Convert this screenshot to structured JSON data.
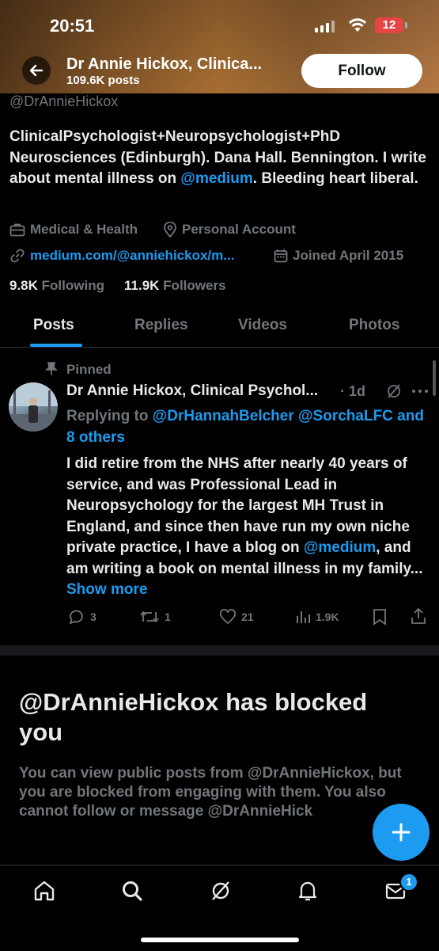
{
  "status_bar": {
    "time": "20:51",
    "battery": "12"
  },
  "header": {
    "name": "Dr Annie Hickox, Clinica...",
    "posts": "109.6K posts",
    "follow_label": "Follow"
  },
  "profile": {
    "handle": "@DrAnnieHickox",
    "bio_part1": "ClinicalPsychologist+Neuropsychologist+PhD Neurosciences (Edinburgh). Dana Hall. Bennington. I write about mental illness on ",
    "bio_link": "@medium",
    "bio_part2": ". Bleeding heart liberal.",
    "category": "Medical & Health",
    "account_type": "Personal Account",
    "website": "medium.com/@anniehickox/m...",
    "joined": "Joined April 2015",
    "following_count": "9.8K",
    "following_label": "Following",
    "followers_count": "11.9K",
    "followers_label": "Followers"
  },
  "tabs": [
    {
      "label": "Posts"
    },
    {
      "label": "Replies"
    },
    {
      "label": "Videos"
    },
    {
      "label": "Photos"
    }
  ],
  "pinned_post": {
    "pinned_label": "Pinned",
    "author": "Dr Annie Hickox, Clinical Psychol...",
    "time": "· 1d",
    "replying_prefix": "Replying to ",
    "replying_users": "@DrHannahBelcher @SorchaLFC and 8 others",
    "text_part1": "I did retire from the NHS after nearly 40 years of service, and was Professional Lead in Neuropsychology for the largest MH Trust in England, and since then have run my own niche private practice, I have a blog on ",
    "text_link": "@medium",
    "text_part2": ", and am writing a book on mental illness in my family... ",
    "show_more": "Show more",
    "replies": "3",
    "reposts": "1",
    "likes": "21",
    "views": "1.9K"
  },
  "blocked": {
    "title": "@DrAnnieHickox has blocked you",
    "text": "You can view public posts from @DrAnnieHickox, but you are blocked from engaging with them. You also cannot follow or message @DrAnnieHick"
  },
  "nav": {
    "messages_badge": "1"
  },
  "colors": {
    "accent": "#1d9bf0",
    "background": "#000000",
    "muted": "#71767b",
    "text": "#e7e9ea"
  }
}
